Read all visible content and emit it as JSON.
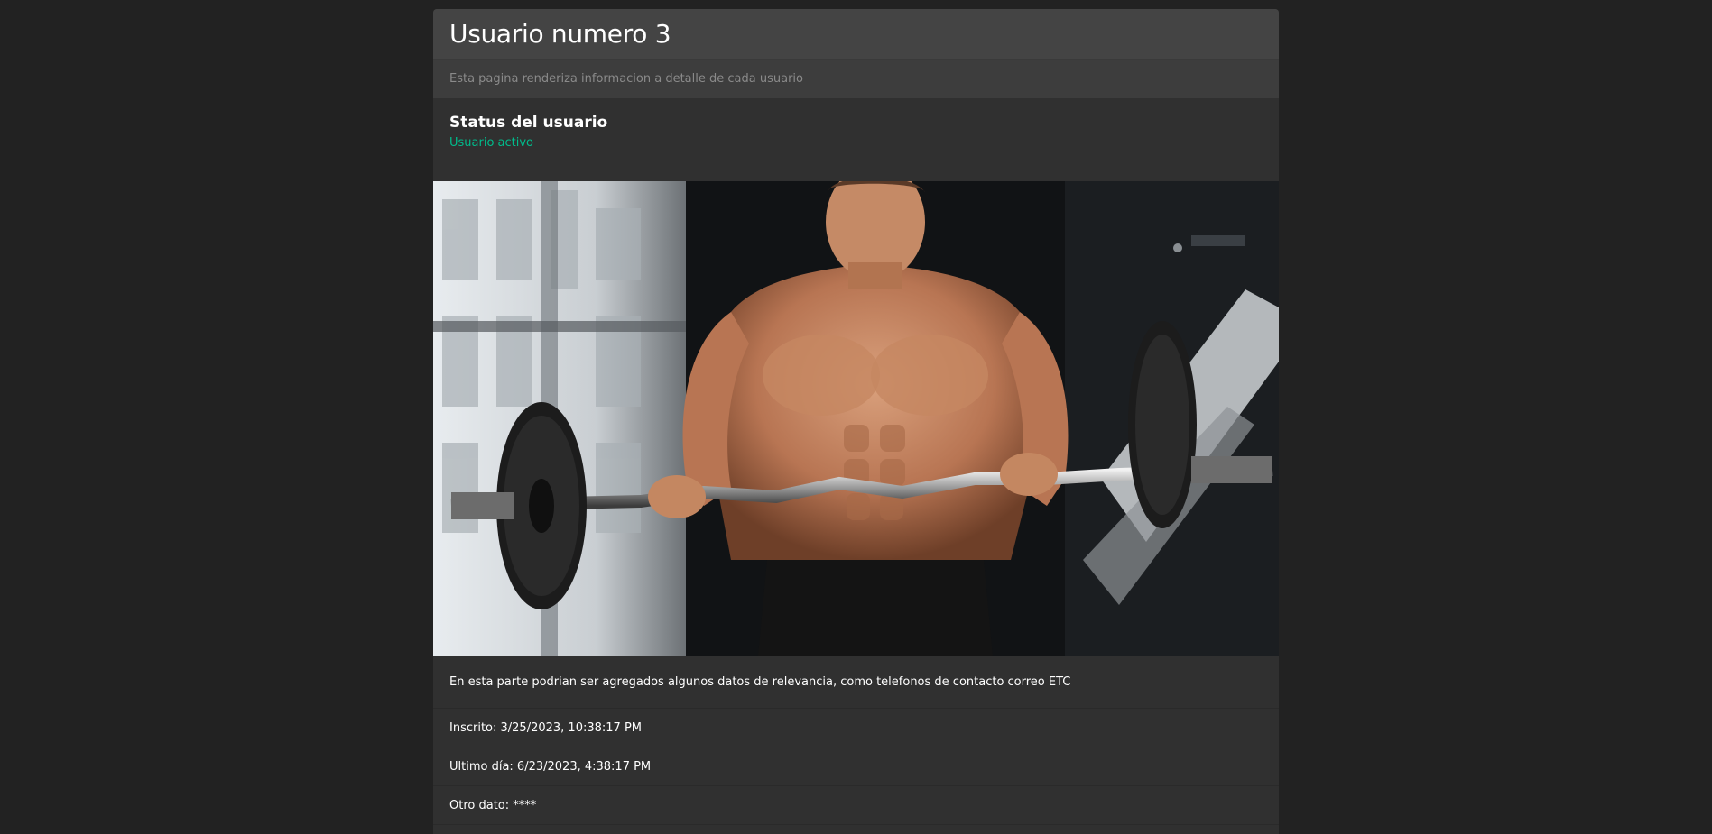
{
  "page": {
    "title": "Usuario numero 3",
    "subtitle": "Esta pagina renderiza informacion a detalle de cada usuario"
  },
  "status": {
    "heading": "Status del usuario",
    "value": "Usuario activo",
    "color": "#00bc8c"
  },
  "hero_image": {
    "alt": "Hombre levantando barra con pesas en el gimnasio"
  },
  "details": {
    "description": "En esta parte podrian ser agregados algunos datos de relevancia, como telefonos de contacto correo ETC",
    "inscrito": "Inscrito: 3/25/2023, 10:38:17 PM",
    "ultimo_dia": "Ultimo día: 6/23/2023, 4:38:17 PM",
    "otro_dato": "Otro dato: ****"
  },
  "colors": {
    "background": "#222222",
    "card": "#303030",
    "header": "#444444",
    "accent": "#00bc8c"
  }
}
